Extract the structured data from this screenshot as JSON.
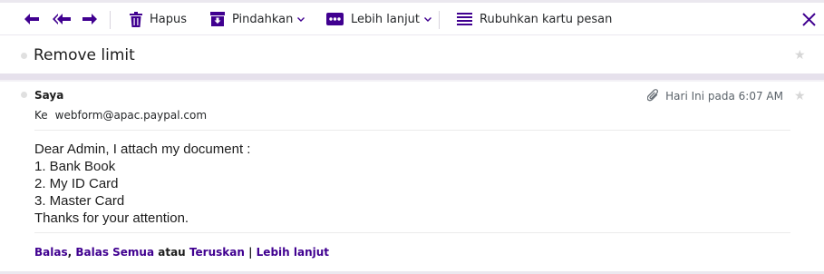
{
  "toolbar": {
    "reply_icon": "reply-icon",
    "reply_all_icon": "reply-all-icon",
    "forward_icon": "forward-icon",
    "delete_label": "Hapus",
    "move_label": "Pindahkan",
    "more_label": "Lebih lanjut",
    "summarize_label": "Rubuhkan kartu pesan",
    "close_icon": "close-icon"
  },
  "message": {
    "subject": "Remove limit",
    "sender": "Saya",
    "to_label": "Ke",
    "to_address": "webform@apac.paypal.com",
    "timestamp": "Hari Ini pada 6:07 AM",
    "body_lines": [
      "Dear Admin, I attach my document :",
      "1. Bank Book",
      "2. My ID Card",
      "3. Master Card",
      "Thanks for your attention."
    ]
  },
  "actions": {
    "reply": "Balas",
    "comma": ",",
    "reply_all": "Balas Semua",
    "or": "atau",
    "forward": "Teruskan",
    "pipe": "|",
    "more": "Lebih lanjut"
  },
  "colors": {
    "accent": "#400090",
    "band": "#e6e1ec"
  }
}
